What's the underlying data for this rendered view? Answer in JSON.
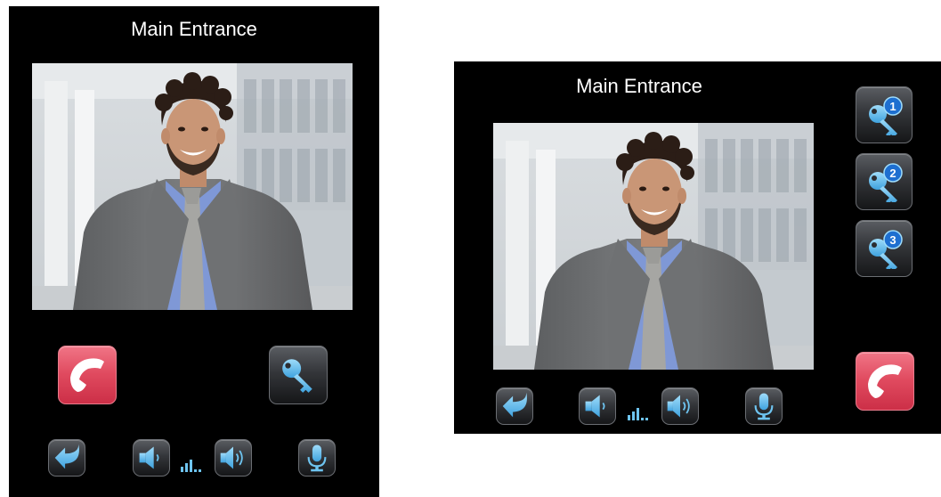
{
  "screens": {
    "portrait": {
      "title": "Main Entrance"
    },
    "landscape": {
      "title": "Main Entrance"
    }
  },
  "icons": {
    "hangup": "phone-hangup-icon",
    "unlock": "key-icon",
    "back": "back-arrow-icon",
    "volume_down": "speaker-low-icon",
    "volume_up": "speaker-high-icon",
    "volume_level": "signal-level-icon",
    "microphone": "microphone-icon",
    "door_keys": [
      "1",
      "2",
      "3"
    ]
  },
  "colors": {
    "screen_background": "#000000",
    "hangup_red": "#e04a5f",
    "icon_blue": "#6ec4f0",
    "badge_blue": "#1e6fd0"
  }
}
